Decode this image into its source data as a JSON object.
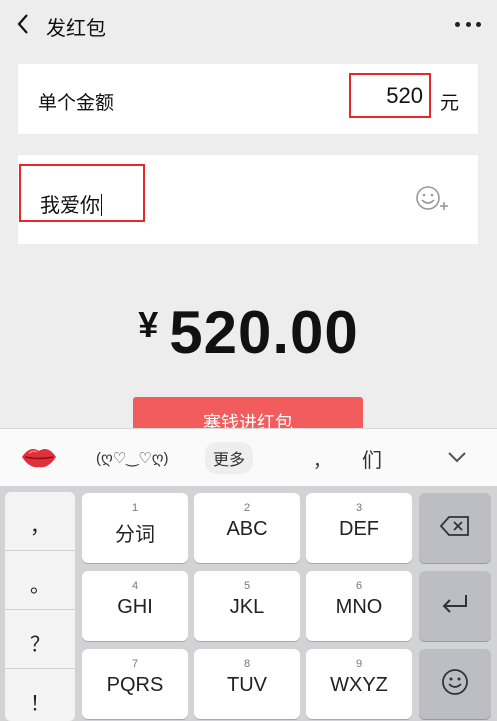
{
  "header": {
    "title": "发红包"
  },
  "amount": {
    "label": "单个金额",
    "value": "520",
    "unit": "元"
  },
  "message": {
    "value": "我爱你"
  },
  "display": {
    "currency": "¥",
    "total": "520.00"
  },
  "submit": {
    "label": "塞钱进红包"
  },
  "ime": {
    "kaomoji": "(ღ♡‿♡ღ)",
    "more": "更多",
    "comma": "，",
    "suggestion": "们"
  },
  "keyboard": {
    "punctuation": [
      "，",
      "。",
      "？",
      "！"
    ],
    "keys": [
      {
        "num": "1",
        "label": "分词"
      },
      {
        "num": "2",
        "label": "ABC"
      },
      {
        "num": "3",
        "label": "DEF"
      },
      {
        "num": "4",
        "label": "GHI"
      },
      {
        "num": "5",
        "label": "JKL"
      },
      {
        "num": "6",
        "label": "MNO"
      },
      {
        "num": "7",
        "label": "PQRS"
      },
      {
        "num": "8",
        "label": "TUV"
      },
      {
        "num": "9",
        "label": "WXYZ"
      }
    ]
  }
}
